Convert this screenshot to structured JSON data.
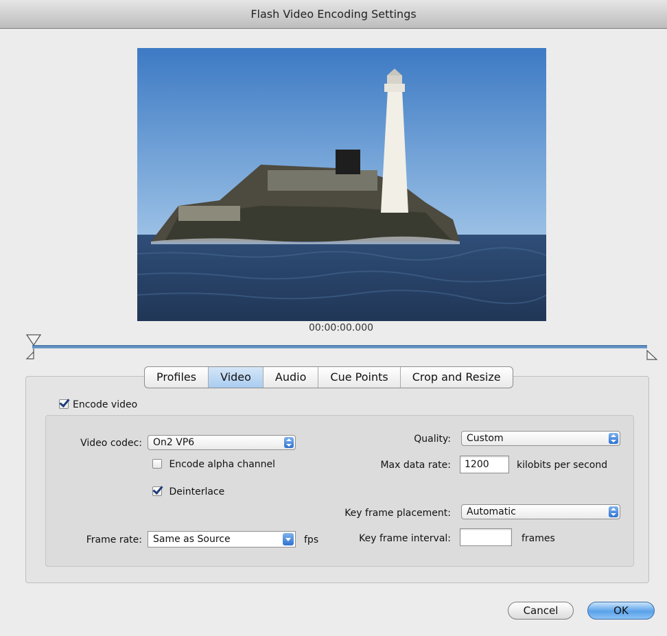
{
  "window": {
    "title": "Flash Video Encoding Settings"
  },
  "preview": {
    "timecode": "00:00:00.000"
  },
  "tabs": [
    {
      "label": "Profiles",
      "active": false
    },
    {
      "label": "Video",
      "active": true
    },
    {
      "label": "Audio",
      "active": false
    },
    {
      "label": "Cue Points",
      "active": false
    },
    {
      "label": "Crop and Resize",
      "active": false
    }
  ],
  "video": {
    "encode_video": {
      "label": "Encode video",
      "checked": true
    },
    "codec": {
      "label": "Video codec:",
      "value": "On2 VP6"
    },
    "encode_alpha": {
      "label": "Encode alpha channel",
      "checked": false
    },
    "deinterlace": {
      "label": "Deinterlace",
      "checked": true
    },
    "frame_rate": {
      "label": "Frame rate:",
      "value": "Same as Source",
      "unit": "fps"
    },
    "quality": {
      "label": "Quality:",
      "value": "Custom"
    },
    "max_data_rate": {
      "label": "Max data rate:",
      "value": "1200",
      "unit": "kilobits per second"
    },
    "key_frame_placement": {
      "label": "Key frame placement:",
      "value": "Automatic"
    },
    "key_frame_interval": {
      "label": "Key frame interval:",
      "value": "",
      "unit": "frames"
    }
  },
  "buttons": {
    "cancel": "Cancel",
    "ok": "OK"
  },
  "colors": {
    "accent": "#5aa2ea",
    "active_tab": "#a9ccf0",
    "scrubber": "#5f8fc2"
  }
}
